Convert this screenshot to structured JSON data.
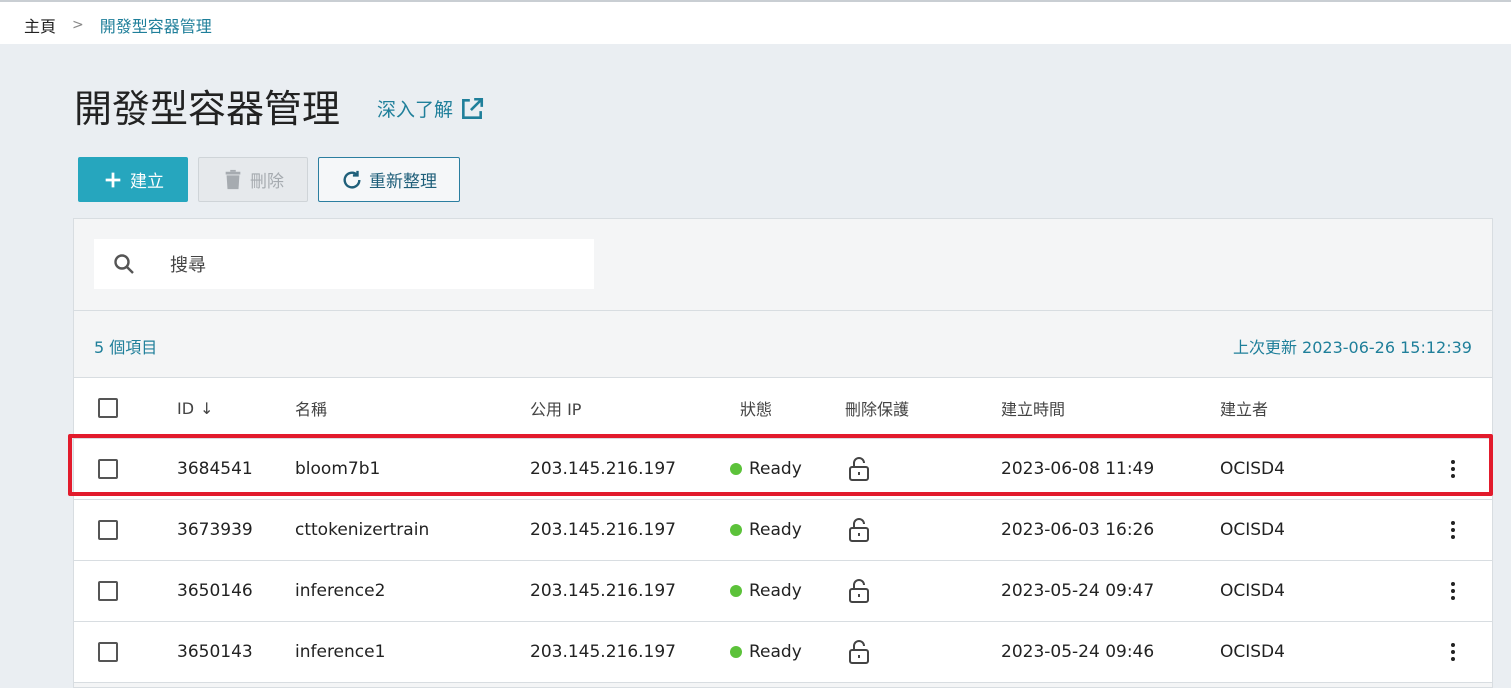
{
  "breadcrumb": {
    "home": "主頁",
    "separator": ">",
    "current": "開發型容器管理"
  },
  "page": {
    "title": "開發型容器管理",
    "learn_more": "深入了解"
  },
  "toolbar": {
    "create_label": "建立",
    "delete_label": "刪除",
    "refresh_label": "重新整理"
  },
  "search": {
    "placeholder": "搜尋",
    "value": ""
  },
  "summary": {
    "item_count": "5 個項目",
    "last_update": "上次更新 2023-06-26 15:12:39"
  },
  "table": {
    "columns": {
      "id": "ID",
      "name": "名稱",
      "ip": "公用 IP",
      "status": "狀態",
      "protect": "刪除保護",
      "created": "建立時間",
      "creator": "建立者"
    },
    "rows": [
      {
        "id": "3684541",
        "name": "bloom7b1",
        "ip": "203.145.216.197",
        "status": "Ready",
        "created": "2023-06-08 11:49",
        "creator": "OCISD4"
      },
      {
        "id": "3673939",
        "name": "cttokenizertrain",
        "ip": "203.145.216.197",
        "status": "Ready",
        "created": "2023-06-03 16:26",
        "creator": "OCISD4"
      },
      {
        "id": "3650146",
        "name": "inference2",
        "ip": "203.145.216.197",
        "status": "Ready",
        "created": "2023-05-24 09:47",
        "creator": "OCISD4"
      },
      {
        "id": "3650143",
        "name": "inference1",
        "ip": "203.145.216.197",
        "status": "Ready",
        "created": "2023-05-24 09:46",
        "creator": "OCISD4"
      }
    ]
  },
  "icons": {
    "create": "plus-icon",
    "delete": "trash-icon",
    "refresh": "refresh-icon",
    "learn_more": "external-link-icon",
    "search": "search-icon",
    "protect": "unlocked-icon",
    "row_menu": "more-vertical-icon",
    "sort": "arrow-down-icon"
  },
  "colors": {
    "accent": "#26a6be",
    "link": "#1f7f9a",
    "status_ready": "#5cc23a",
    "highlight": "#e21b2c"
  }
}
